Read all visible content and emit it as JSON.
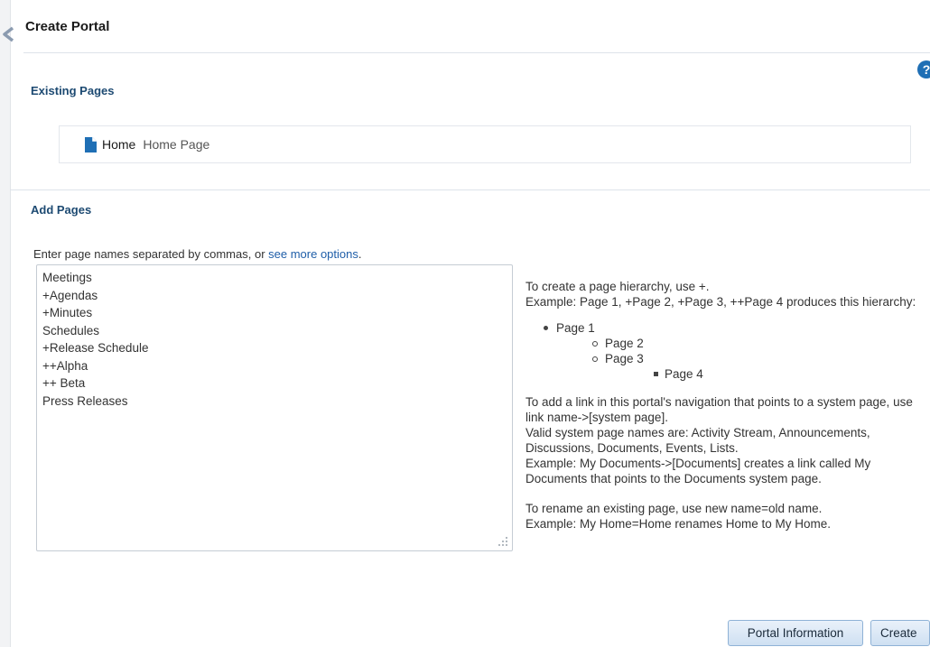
{
  "header": {
    "title": "Create Portal",
    "help_icon_glyph": "?"
  },
  "existing_pages": {
    "heading": "Existing Pages",
    "items": [
      {
        "name": "Home",
        "description": "Home Page",
        "icon": "page-icon"
      }
    ]
  },
  "add_pages": {
    "heading": "Add Pages",
    "instructions_prefix": "Enter page names separated by commas, or ",
    "more_options_link": "see more options",
    "instructions_suffix": ".",
    "textarea_value": "Meetings\n+Agendas\n+Minutes\nSchedules\n+Release Schedule\n++Alpha\n++ Beta\nPress Releases"
  },
  "help": {
    "hierarchy_intro_1": "To create a page hierarchy, use +.",
    "hierarchy_intro_2": "Example: Page 1, +Page 2, +Page 3, ++Page 4 produces this hierarchy:",
    "tree": {
      "level1": "Page 1",
      "level2": [
        "Page 2",
        "Page 3"
      ],
      "level3": "Page 4"
    },
    "link_para": "To add a link in this portal's navigation that points to a system page, use link name->[system page].",
    "valid_names": "Valid system page names are: Activity Stream, Announcements, Discussions, Documents, Events, Lists.",
    "link_example": "Example: My Documents->[Documents] creates a link called My Documents that points to the Documents system page.",
    "rename_para": "To rename an existing page, use new name=old name.",
    "rename_example": "Example: My Home=Home renames Home to My Home."
  },
  "buttons": {
    "portal_information": "Portal Information",
    "create": "Create"
  },
  "colors": {
    "heading": "#1d4a72",
    "link": "#1f5ea8",
    "page_icon": "#1f6fb5",
    "button_border": "#8fb2d6"
  }
}
